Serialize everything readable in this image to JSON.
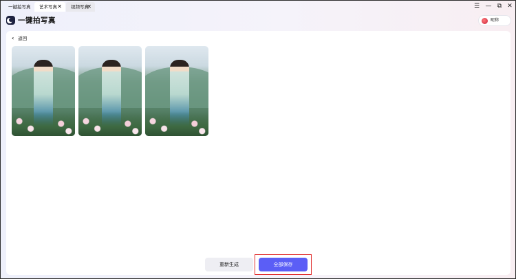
{
  "tabs": [
    {
      "label": "一键拍写真",
      "closable": false
    },
    {
      "label": "艺术写真",
      "closable": true
    },
    {
      "label": "视频写真",
      "closable": true
    }
  ],
  "close_glyph": "✕",
  "window_controls": {
    "menu": "☰",
    "minimize": "—",
    "restore": "⧉",
    "close": "✕"
  },
  "app": {
    "title": "一键拍写真"
  },
  "user": {
    "name": "昵称"
  },
  "back": {
    "chevron": "‹",
    "label": "返回"
  },
  "photos": [
    {
      "alt": "hanfu portrait 1"
    },
    {
      "alt": "hanfu portrait 2"
    },
    {
      "alt": "hanfu portrait 3"
    }
  ],
  "actions": {
    "regenerate": "重新生成",
    "save_all": "全部保存"
  },
  "colors": {
    "accent": "#5b5ef6",
    "highlight": "#e02a2a"
  }
}
